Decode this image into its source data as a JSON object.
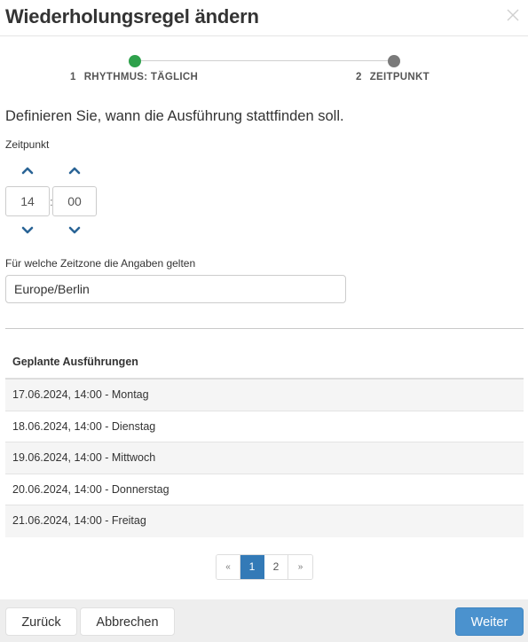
{
  "dialog": {
    "title": "Wiederholungsregel ändern"
  },
  "steps": [
    {
      "number": "1",
      "label": "RHYTHMUS: TÄGLICH",
      "color": "#2ea14b",
      "state": "completed"
    },
    {
      "number": "2",
      "label": "ZEITPUNKT",
      "color": "#7a7a7a",
      "state": "current"
    }
  ],
  "instruction": "Definieren Sie, wann die Ausführung stattfinden soll.",
  "time": {
    "label": "Zeitpunkt",
    "hour": "14",
    "minute": "00",
    "separator": ":",
    "arrow_color": "#2a6496"
  },
  "timezone": {
    "label": "Für welche Zeitzone die Angaben gelten",
    "value": "Europe/Berlin"
  },
  "scheduled": {
    "header": "Geplante Ausführungen",
    "rows": [
      "17.06.2024, 14:00 - Montag",
      "18.06.2024, 14:00 - Dienstag",
      "19.06.2024, 14:00 - Mittwoch",
      "20.06.2024, 14:00 - Donnerstag",
      "21.06.2024, 14:00 - Freitag"
    ]
  },
  "pagination": {
    "prev": "«",
    "pages": [
      "1",
      "2"
    ],
    "active_page": "1",
    "next": "»",
    "active_color": "#337ab7"
  },
  "footer": {
    "back_label": "Zurück",
    "cancel_label": "Abbrechen",
    "next_label": "Weiter",
    "primary_color": "#4b92ce"
  }
}
